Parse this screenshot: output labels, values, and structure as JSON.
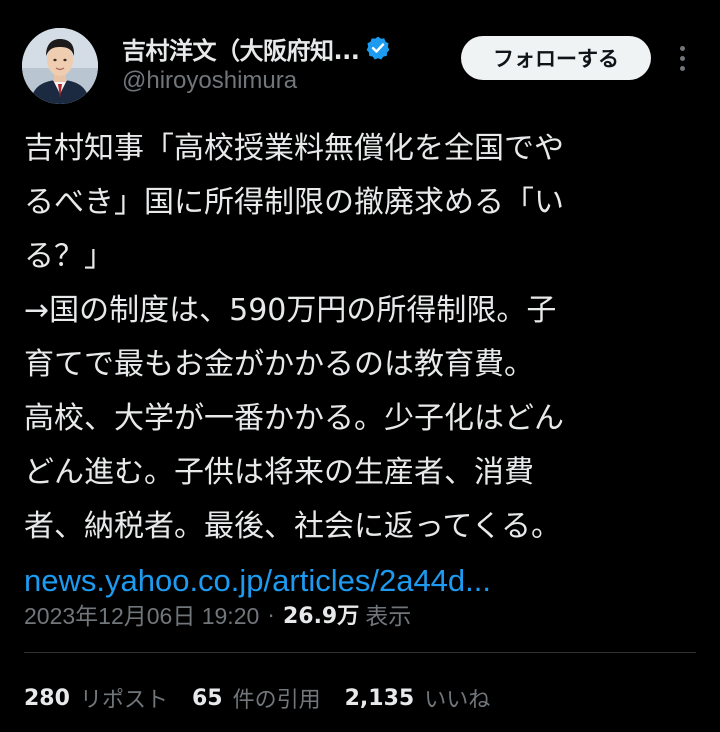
{
  "author": {
    "display_name": "吉村洋文（大阪府知...",
    "handle": "@hiroyoshimura",
    "verified": true,
    "avatar_icon": "profile-photo"
  },
  "actions": {
    "follow_label": "フォローする",
    "more_icon": "more-vertical-icon"
  },
  "tweet": {
    "lines": [
      "吉村知事「高校授業料無償化を全国でや",
      "るべき」国に所得制限の撤廃求める「い",
      "る？」",
      "→国の制度は、590万円の所得制限。子",
      "育てで最もお金がかかるのは教育費。",
      "高校、大学が一番かかる。少子化はどん",
      "どん進む。子供は将来の生産者、消費",
      "者、納税者。最後、社会に返ってくる。"
    ],
    "link_text": "news.yahoo.co.jp/articles/2a44d..."
  },
  "meta": {
    "timestamp": "2023年12月06日 19:20",
    "separator": "·",
    "views_count": "26.9万",
    "views_label": "表示"
  },
  "stats": {
    "reposts_count": "280",
    "reposts_label": "リポスト",
    "quotes_count": "65",
    "quotes_label": "件の引用",
    "likes_count": "2,135",
    "likes_label": "いいね"
  },
  "colors": {
    "background": "#000000",
    "text": "#e7e9ea",
    "secondary_text": "#71767b",
    "link": "#1d9bf0",
    "verified_badge": "#1d9bf0",
    "follow_button_bg": "#eff3f4",
    "divider": "#2f3336"
  }
}
